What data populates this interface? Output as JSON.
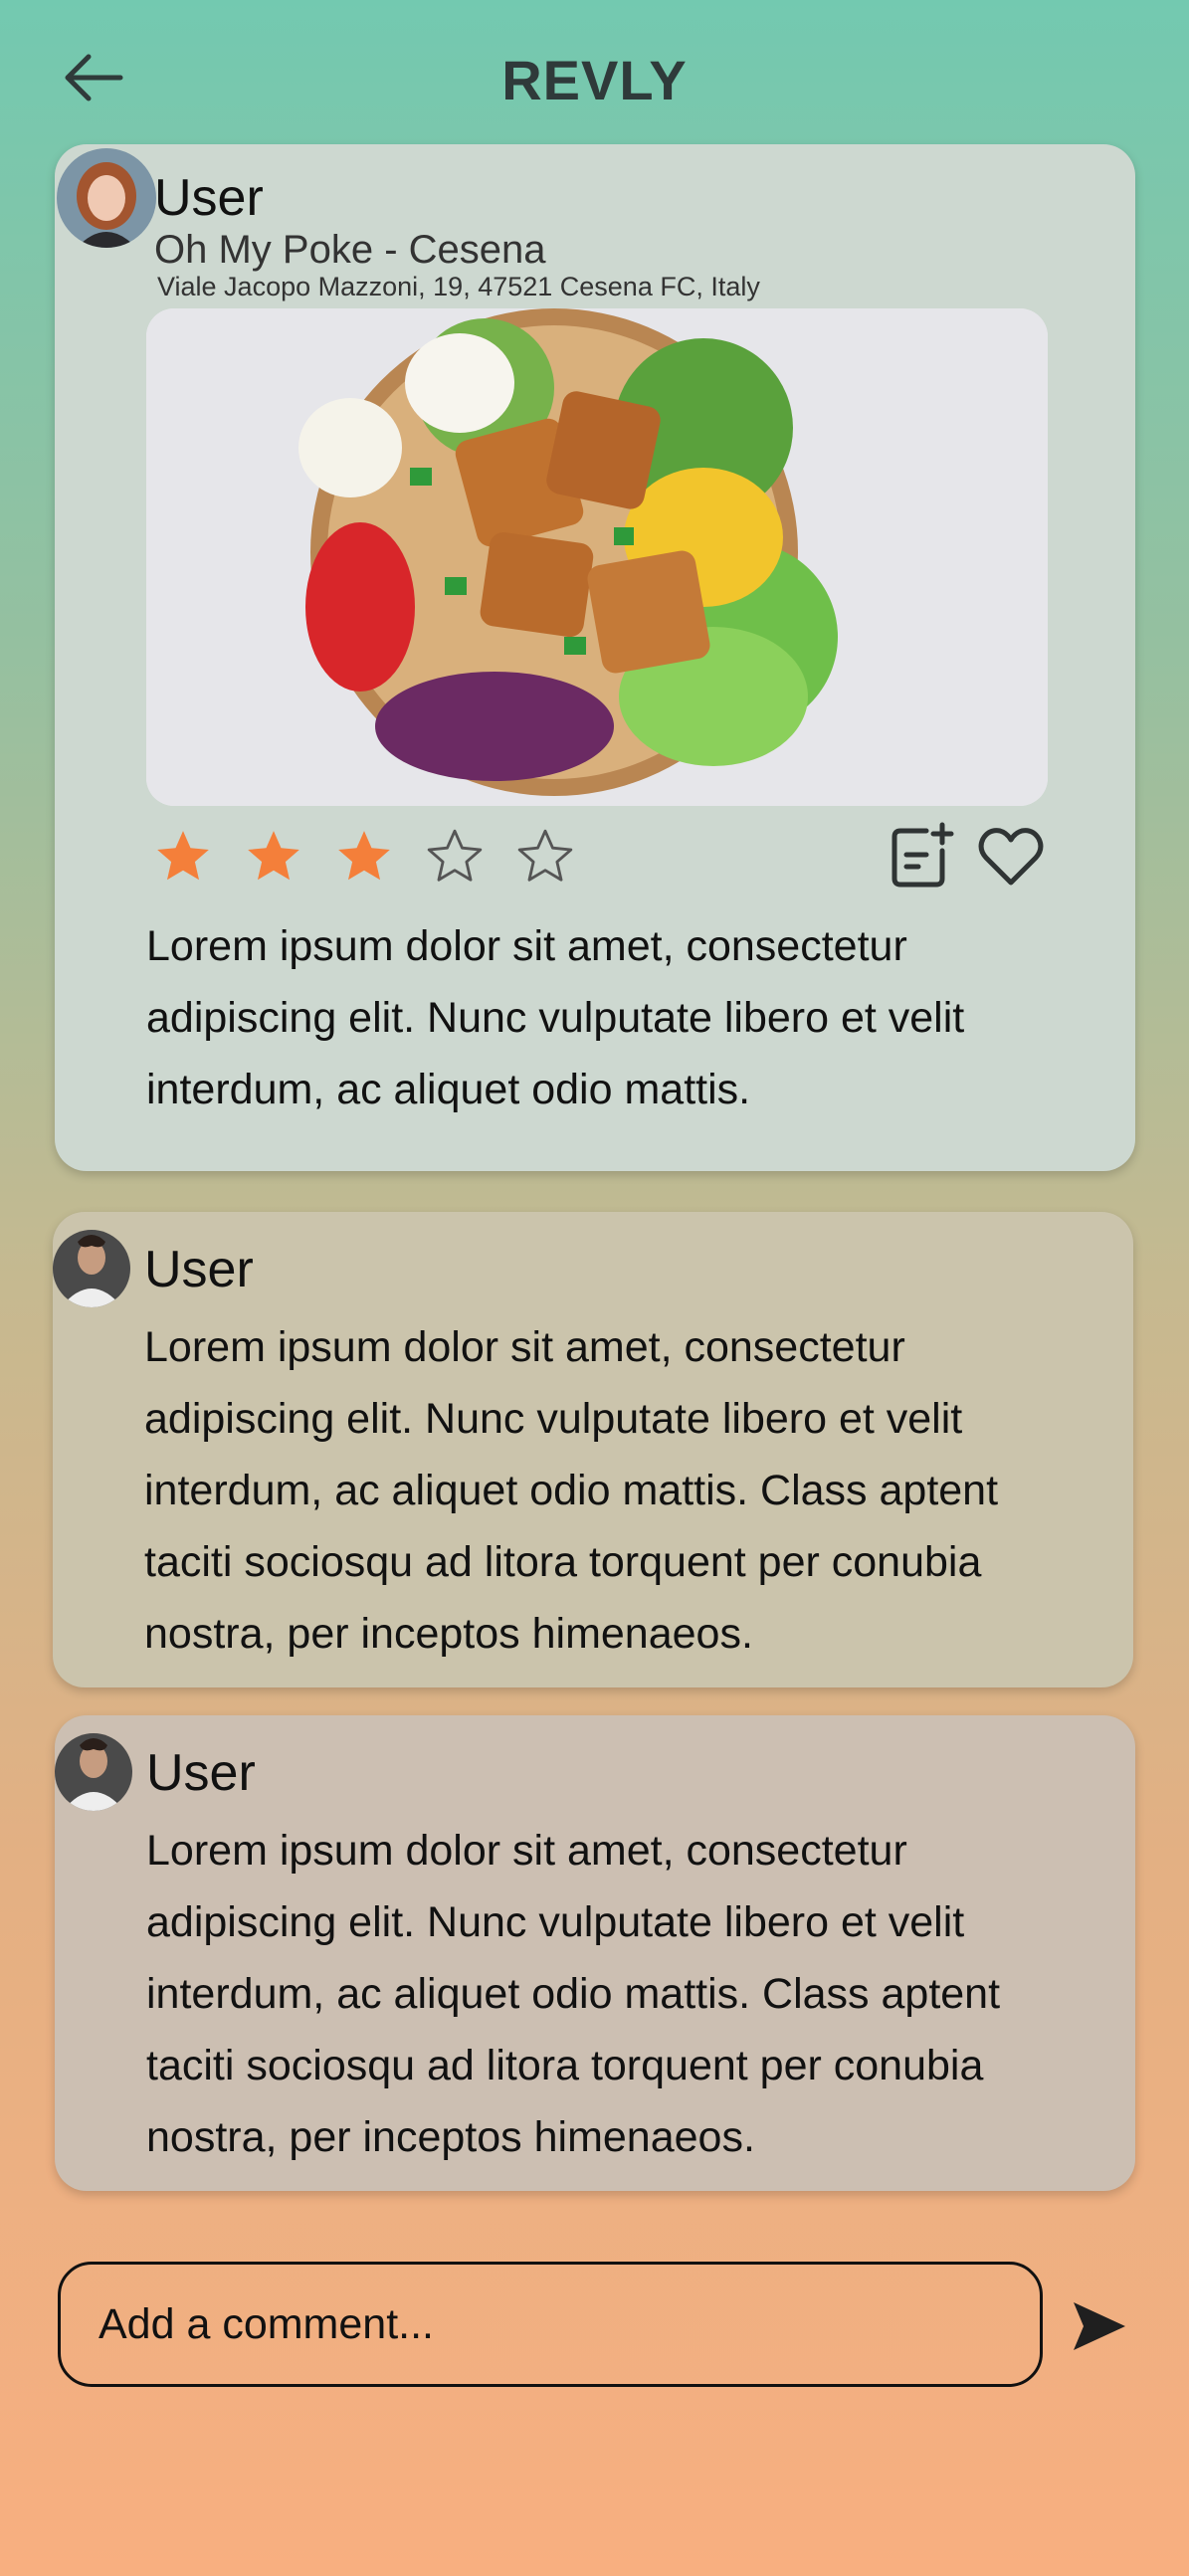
{
  "header": {
    "title": "REVLY"
  },
  "post": {
    "user": "User",
    "restaurant": "Oh My Poke - Cesena",
    "address": "Viale Jacopo Mazzoni, 19, 47521 Cesena FC, Italy",
    "rating": 3,
    "rating_max": 5,
    "text": "Lorem ipsum dolor sit amet, consectetur adipiscing elit. Nunc vulputate libero et velit interdum, ac aliquet odio mattis."
  },
  "comments": [
    {
      "user": "User",
      "text": "Lorem ipsum dolor sit amet, consectetur adipiscing elit. Nunc vulputate libero et velit interdum, ac aliquet odio mattis. Class aptent taciti sociosqu ad litora torquent per conubia nostra, per inceptos himenaeos."
    },
    {
      "user": "User",
      "text": "Lorem ipsum dolor sit amet, consectetur adipiscing elit. Nunc vulputate libero et velit interdum, ac aliquet odio mattis. Class aptent taciti sociosqu ad litora torquent per conubia nostra, per inceptos himenaeos."
    }
  ],
  "comment_input": {
    "placeholder": "Add a comment..."
  },
  "icons": {
    "back": "arrow-left-icon",
    "star_filled": "star-filled-icon",
    "star_empty": "star-outline-icon",
    "note": "note-add-icon",
    "like": "heart-icon",
    "send": "send-icon"
  },
  "colors": {
    "star": "#f47f3a",
    "accent": "#2f3a3a"
  }
}
